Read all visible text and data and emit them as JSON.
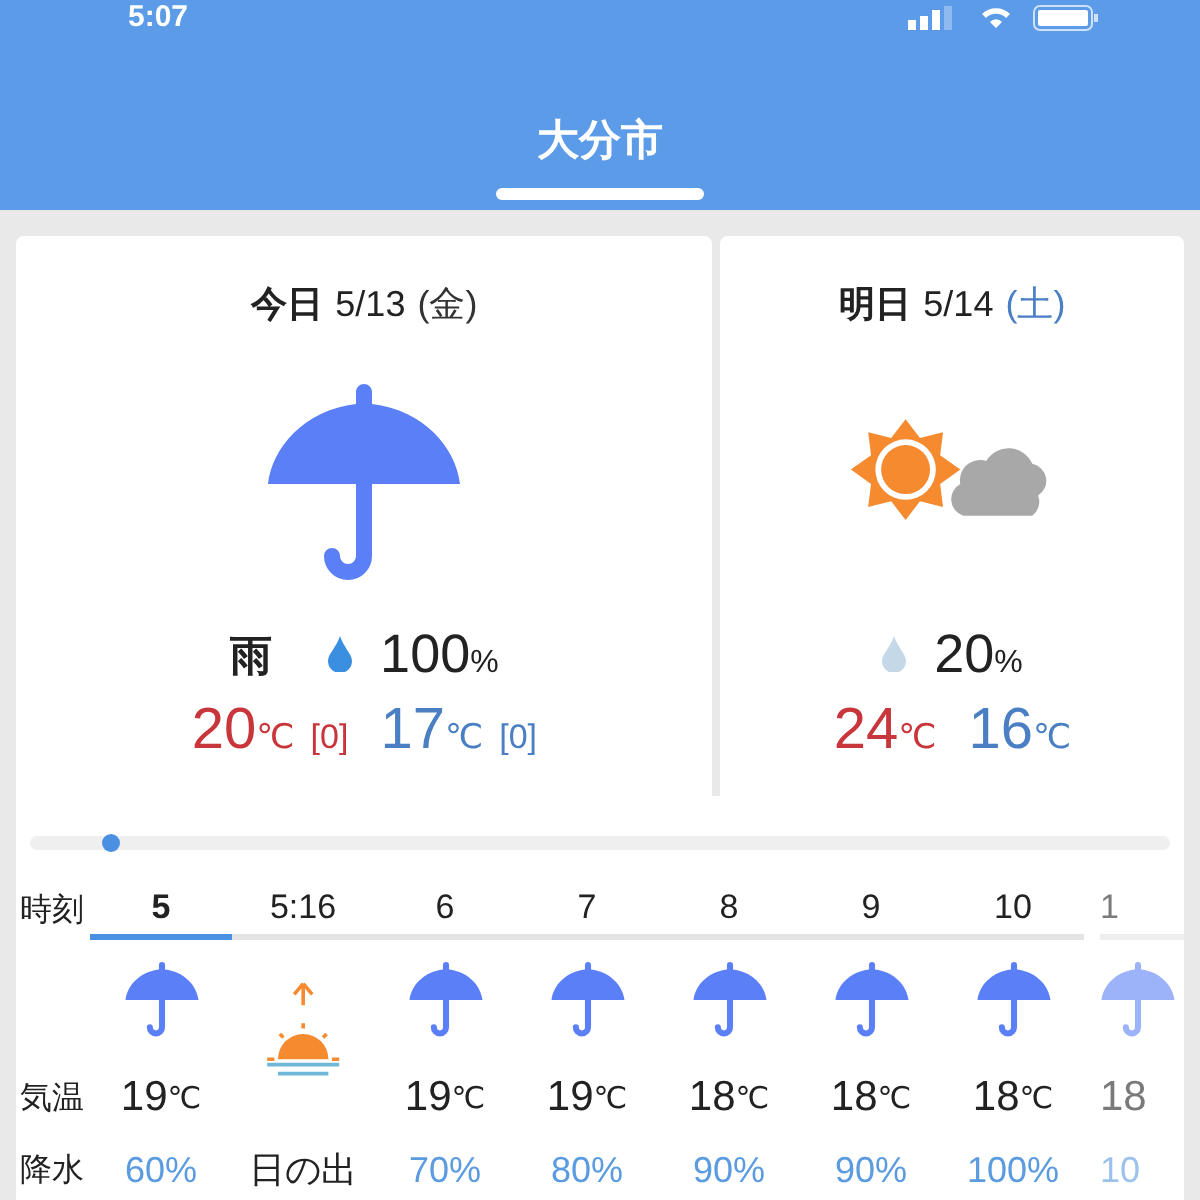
{
  "status_bar": {
    "time": "5:07"
  },
  "header": {
    "title": "大分市"
  },
  "days": [
    {
      "label": "今日",
      "date": "5/13",
      "weekday": "(金)",
      "saturday": false,
      "kind": "rain",
      "condition": "雨",
      "rain_likely": true,
      "precip": "100",
      "precip_unit": "%",
      "high": "20",
      "high_unit": "℃",
      "high_diff": "[0]",
      "low": "17",
      "low_unit": "℃",
      "low_diff": "[0]"
    },
    {
      "label": "明日",
      "date": "5/14",
      "weekday": "(土)",
      "saturday": true,
      "kind": "sun_cloud",
      "rain_likely": false,
      "precip": "20",
      "precip_unit": "%",
      "high": "24",
      "high_unit": "℃",
      "low": "16",
      "low_unit": "℃"
    }
  ],
  "timeline": {
    "level": 0.07
  },
  "hourly": {
    "row_labels": [
      "時刻",
      "気温",
      "降水"
    ],
    "columns": [
      {
        "time": "5",
        "kind": "rain",
        "temp": "19",
        "unit": "℃",
        "precip": "60%",
        "selected": true,
        "faded": false
      },
      {
        "time": "5:16",
        "kind": "sunrise",
        "precip": "日の出",
        "selected": false,
        "faded": false
      },
      {
        "time": "6",
        "kind": "rain",
        "temp": "19",
        "unit": "℃",
        "precip": "70%",
        "selected": false,
        "faded": false
      },
      {
        "time": "7",
        "kind": "rain",
        "temp": "19",
        "unit": "℃",
        "precip": "80%",
        "selected": false,
        "faded": false
      },
      {
        "time": "8",
        "kind": "rain",
        "temp": "18",
        "unit": "℃",
        "precip": "90%",
        "selected": false,
        "faded": false
      },
      {
        "time": "9",
        "kind": "rain",
        "temp": "18",
        "unit": "℃",
        "precip": "90%",
        "selected": false,
        "faded": false
      },
      {
        "time": "10",
        "kind": "rain",
        "temp": "18",
        "unit": "℃",
        "precip": "100%",
        "selected": false,
        "faded": false
      },
      {
        "time": "1",
        "kind": "rain",
        "temp": "18",
        "precip": "10",
        "selected": false,
        "faded": true
      }
    ]
  }
}
